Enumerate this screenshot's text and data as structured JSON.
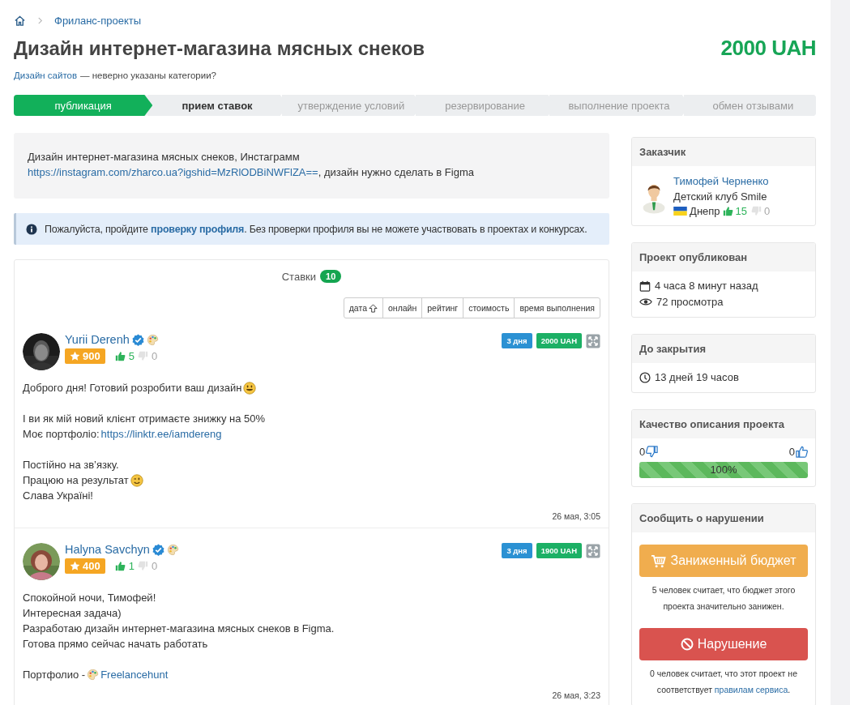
{
  "breadcrumb": {
    "label": "Фриланс-проекты"
  },
  "title": "Дизайн интернет-магазина мясных снеков",
  "budget": "2000 UAH",
  "category": {
    "link": "Дизайн сайтов",
    "note": "— неверно указаны категории?"
  },
  "steps": [
    {
      "label": "публикация",
      "done": true,
      "selected": false
    },
    {
      "label": "прием ставок",
      "done": false,
      "selected": true
    },
    {
      "label": "утверждение условий",
      "done": false,
      "selected": false
    },
    {
      "label": "резервирование",
      "done": false,
      "selected": false
    },
    {
      "label": "выполнение проекта",
      "done": false,
      "selected": false
    },
    {
      "label": "обмен отзывами",
      "done": false,
      "selected": false
    }
  ],
  "description": [
    {
      "text": "Дизайн интернет-магазина мясных снеков, Инстаграмм "
    },
    {
      "link": "https://instagram.com/zharco.ua?igshid=MzRlODBiNWFlZA=="
    },
    {
      "text": ", дизайн нужно сделать в Figma"
    }
  ],
  "notice": [
    {
      "text": "Пожалуйста, пройдите "
    },
    {
      "link": "проверку профиля"
    },
    {
      "text": ". Без проверки профиля вы не можете участвовать в проектах и конкурсах."
    }
  ],
  "bids": {
    "label": "Ставки",
    "count": "10",
    "sort": [
      {
        "label": "дата",
        "sorted": true
      },
      {
        "label": "онлайн",
        "sorted": false
      },
      {
        "label": "рейтинг",
        "sorted": false
      },
      {
        "label": "стоимость",
        "sorted": false
      },
      {
        "label": "время выполнения",
        "sorted": false
      }
    ],
    "items": [
      {
        "name": "Yurii Derenh",
        "verified": true,
        "rating": "900",
        "likes": "5",
        "dislikes": "0",
        "days": "3 дня",
        "price": "2000 UAH",
        "time": "26 мая, 3:05",
        "paragraphs": [
          [
            [
              {
                "text": "Доброго дня! Готовий розробити ваш дизайн "
              },
              {
                "kind": "grin"
              }
            ]
          ],
          [
            [
              {
                "text": "І ви як мій новий клієнт отримаєте знижку на 50%"
              }
            ],
            [
              {
                "text": "Моє портфоліо: "
              },
              {
                "link": "https://linktr.ee/iamdereng"
              }
            ]
          ],
          [
            [
              {
                "text": "Постійно на зв’язку."
              }
            ],
            [
              {
                "text": "Працюю на результат"
              },
              {
                "kind": "wink"
              }
            ],
            [
              {
                "text": "Слава Україні!"
              }
            ]
          ]
        ]
      },
      {
        "name": "Halyna Savchyn",
        "verified": true,
        "rating": "400",
        "likes": "1",
        "dislikes": "0",
        "days": "3 дня",
        "price": "1900 UAH",
        "time": "26 мая, 3:23",
        "paragraphs": [
          [
            [
              {
                "text": "Спокойной ночи, Тимофей!"
              }
            ],
            [
              {
                "text": "Интересная задача)"
              }
            ],
            [
              {
                "text": "Разработаю дизайн интернет-магазина мясных снеков в Figma."
              }
            ],
            [
              {
                "text": "Готова прямо сейчас начать работать"
              }
            ]
          ],
          [
            [
              {
                "text": "Портфолио - "
              },
              {
                "kind": "palette"
              },
              {
                "link": "Freelancehunt"
              }
            ]
          ]
        ]
      }
    ]
  },
  "sidebar": [
    {
      "kind": "customer",
      "title": "Заказчик",
      "name": "Тимофей Черненко",
      "company": "Детский клуб Smile",
      "city": "Днепр",
      "likes": "15",
      "dislikes": "0"
    },
    {
      "kind": "published",
      "title": "Проект опубликован",
      "ago": "4 часа 8 минут назад",
      "views": "72 просмотра"
    },
    {
      "kind": "closing",
      "title": "До закрытия",
      "remaining": "13 дней 19 часов"
    },
    {
      "kind": "quality",
      "title": "Качество описания проекта",
      "dislikes": "0",
      "likes": "0",
      "level": 1,
      "reading": "100%"
    },
    {
      "kind": "report",
      "title": "Сообщить о нарушении",
      "buttons": [
        {
          "kind": "budget",
          "label": "Заниженный бюджет",
          "note": [
            {
              "text": "5 человек считает, что бюджет этого проекта значительно занижен."
            }
          ]
        },
        {
          "kind": "violation",
          "label": "Нарушение",
          "note": [
            {
              "text": "0 человек считает, что этот проект не соответствует "
            },
            {
              "link": "правилам сервиса"
            },
            {
              "text": "."
            }
          ]
        }
      ]
    }
  ]
}
